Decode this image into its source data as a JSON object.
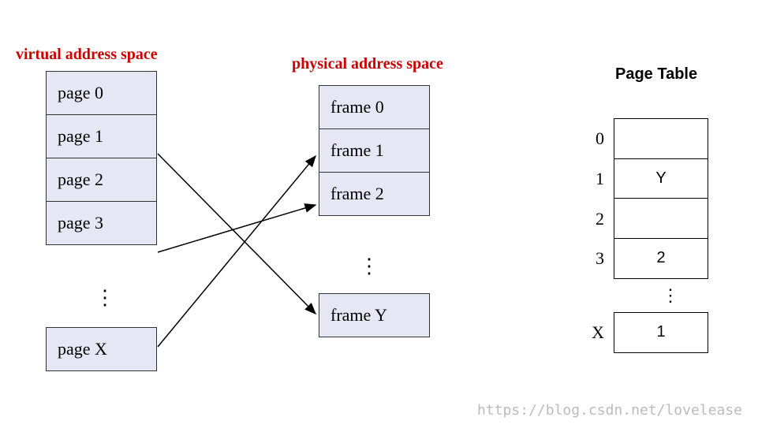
{
  "virtual": {
    "title": "virtual address space",
    "pages_top": [
      "page 0",
      "page 1",
      "page 2",
      "page 3"
    ],
    "page_bottom": "page X"
  },
  "physical": {
    "title": "physical address space",
    "frames_top": [
      "frame 0",
      "frame 1",
      "frame 2"
    ],
    "frame_bottom": "frame Y"
  },
  "page_table": {
    "title": "Page Table",
    "rows_top": [
      {
        "index": "0",
        "value": ""
      },
      {
        "index": "1",
        "value": "Y"
      },
      {
        "index": "2",
        "value": ""
      },
      {
        "index": "3",
        "value": "2"
      }
    ],
    "row_bottom": {
      "index": "X",
      "value": "1"
    }
  },
  "dots": "⋮",
  "watermark": "https://blog.csdn.net/lovelease"
}
